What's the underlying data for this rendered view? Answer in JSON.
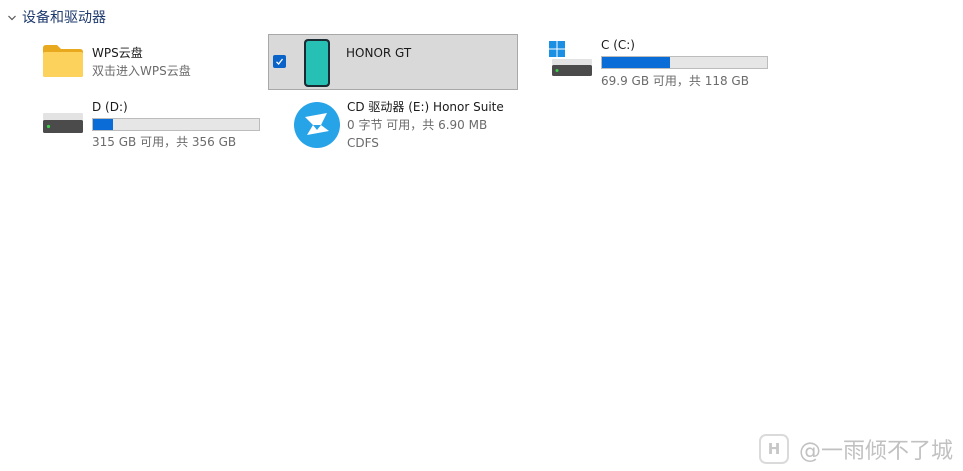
{
  "group": {
    "title": "设备和驱动器"
  },
  "items": {
    "wps": {
      "name": "WPS云盘",
      "sub": "双击进入WPS云盘"
    },
    "honor": {
      "name": "HONOR GT",
      "selected": true
    },
    "c_drive": {
      "name": "C (C:)",
      "space": "69.9 GB 可用，共 118 GB",
      "used_fraction": 0.41
    },
    "d_drive": {
      "name": "D (D:)",
      "space": "315 GB 可用，共 356 GB",
      "used_fraction": 0.12
    },
    "cd_drive": {
      "name": "CD 驱动器 (E:) Honor Suite",
      "space": "0 字节 可用，共 6.90 MB",
      "fs": "CDFS"
    }
  },
  "watermark": {
    "logo": "H",
    "text": "@一雨倾不了城"
  },
  "colors": {
    "accent": "#0a6cd6",
    "group_title": "#1e3a6e",
    "selection_bg": "#d9d9d9"
  }
}
